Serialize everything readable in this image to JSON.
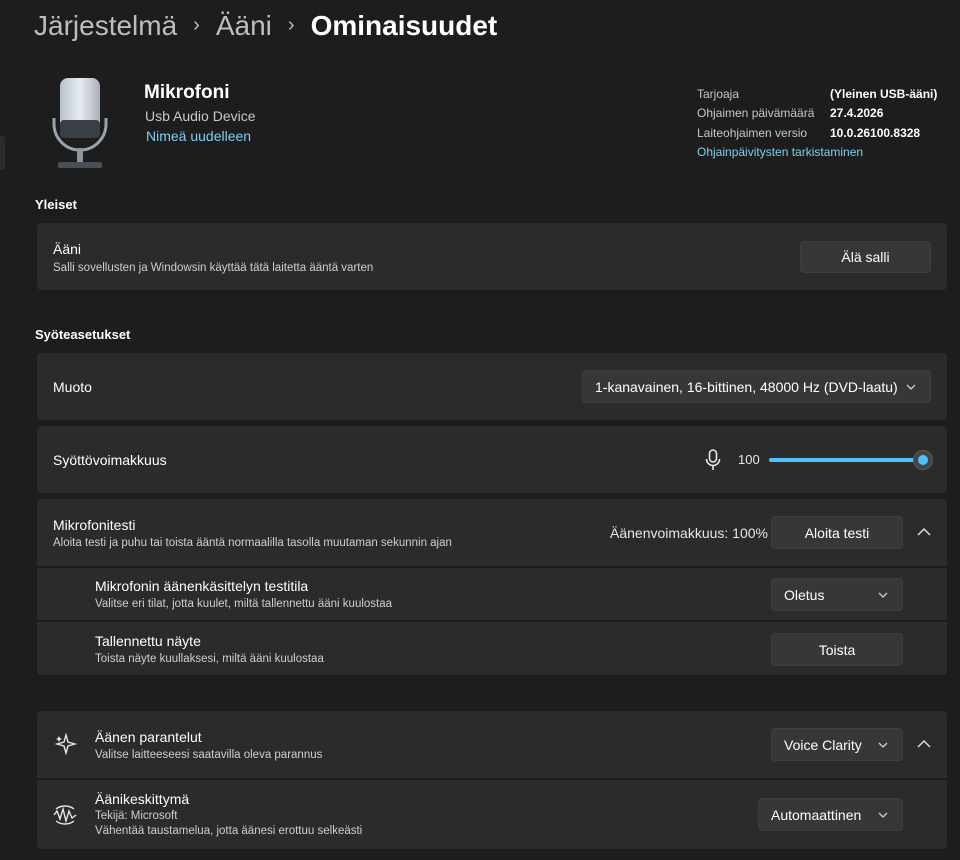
{
  "breadcrumb": {
    "items": [
      "Järjestelmä",
      "Ääni"
    ],
    "current": "Ominaisuudet"
  },
  "device": {
    "name": "Mikrofoni",
    "subtitle": "Usb Audio Device",
    "rename_link": "Nimeä uudelleen",
    "info": [
      {
        "label": "Tarjoaja",
        "value": "(Yleinen USB-ääni)"
      },
      {
        "label": "Ohjaimen päivämäärä",
        "value": "27.4.2026"
      },
      {
        "label": "Laiteohjaimen versio",
        "value": "10.0.26100.8328"
      }
    ],
    "update_link": "Ohjainpäivitysten tarkistaminen"
  },
  "general": {
    "section_title": "Yleiset",
    "audio": {
      "title": "Ääni",
      "description": "Salli sovellusten ja Windowsin käyttää tätä laitetta ääntä varten",
      "button": "Älä salli"
    }
  },
  "input": {
    "section_title": "Syöteasetukset",
    "format": {
      "title": "Muoto",
      "value": "1-kanavainen, 16-bittinen, 48000 Hz (DVD-laatu)"
    },
    "volume": {
      "title": "Syöttövoimakkuus",
      "value": "100",
      "level": 1.0
    },
    "mic_test": {
      "title": "Mikrofonitesti",
      "description": "Aloita testi ja puhu tai toista ääntä normaalilla tasolla muutaman sekunnin ajan",
      "status": "Äänenvoimakkuus: 100%",
      "button": "Aloita testi",
      "test_mode": {
        "title": "Mikrofonin äänenkäsittelyn testitila",
        "description": "Valitse eri tilat, jotta kuulet, miltä tallennettu ääni kuulostaa",
        "value": "Oletus"
      },
      "recorded": {
        "title": "Tallennettu näyte",
        "description": "Toista näyte kuullaksesi, miltä ääni kuulostaa",
        "button": "Toista"
      }
    }
  },
  "enhancements": {
    "title": "Äänen parantelut",
    "description": "Valitse laitteeseesi saatavilla oleva parannus",
    "value": "Voice Clarity",
    "focus": {
      "title": "Äänikeskittymä",
      "author": "Tekijä: Microsoft",
      "description": "Vähentää taustamelua, jotta äänesi erottuu selkeästi",
      "value": "Automaattinen"
    }
  },
  "colors": {
    "accent": "#4cc2ff",
    "link": "#7fcff0",
    "background": "#1d1d1d",
    "card": "#2b2b2b"
  }
}
